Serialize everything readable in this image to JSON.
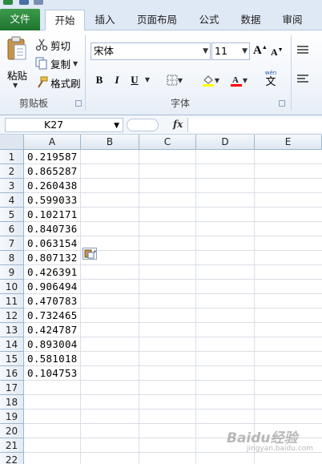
{
  "tabs": [
    "文件",
    "开始",
    "插入",
    "页面布局",
    "公式",
    "数据",
    "审阅"
  ],
  "clipboard": {
    "paste_label": "粘贴",
    "cut_label": "剪切",
    "copy_label": "复制",
    "format_painter_label": "格式刷",
    "group_label": "剪贴板"
  },
  "font": {
    "name": "宋体",
    "size": "11",
    "grow_label": "A",
    "shrink_label": "A",
    "bold_label": "B",
    "italic_label": "I",
    "underline_label": "U",
    "phonetic_label": "wén",
    "phonetic_char": "文",
    "group_label": "字体",
    "fill_color": "#ffff00",
    "font_color": "#ff0000"
  },
  "formula_bar": {
    "name_box": "K27",
    "fx_label": "fx",
    "formula": ""
  },
  "sheet": {
    "columns": [
      "A",
      "B",
      "C",
      "D",
      "E"
    ],
    "rows": [
      "1",
      "2",
      "3",
      "4",
      "5",
      "6",
      "7",
      "8",
      "9",
      "10",
      "11",
      "12",
      "13",
      "14",
      "15",
      "16",
      "17",
      "18",
      "19",
      "20",
      "21",
      "22"
    ],
    "column_a_values": [
      "0.219587",
      "0.865287",
      "0.260438",
      "0.599033",
      "0.102171",
      "0.840736",
      "0.063154",
      "0.807132",
      "0.426391",
      "0.906494",
      "0.470783",
      "0.732465",
      "0.424787",
      "0.893004",
      "0.581018",
      "0.104753"
    ]
  },
  "watermark": {
    "text": "Baidu经验",
    "sub": "jingyan.baidu.com"
  }
}
